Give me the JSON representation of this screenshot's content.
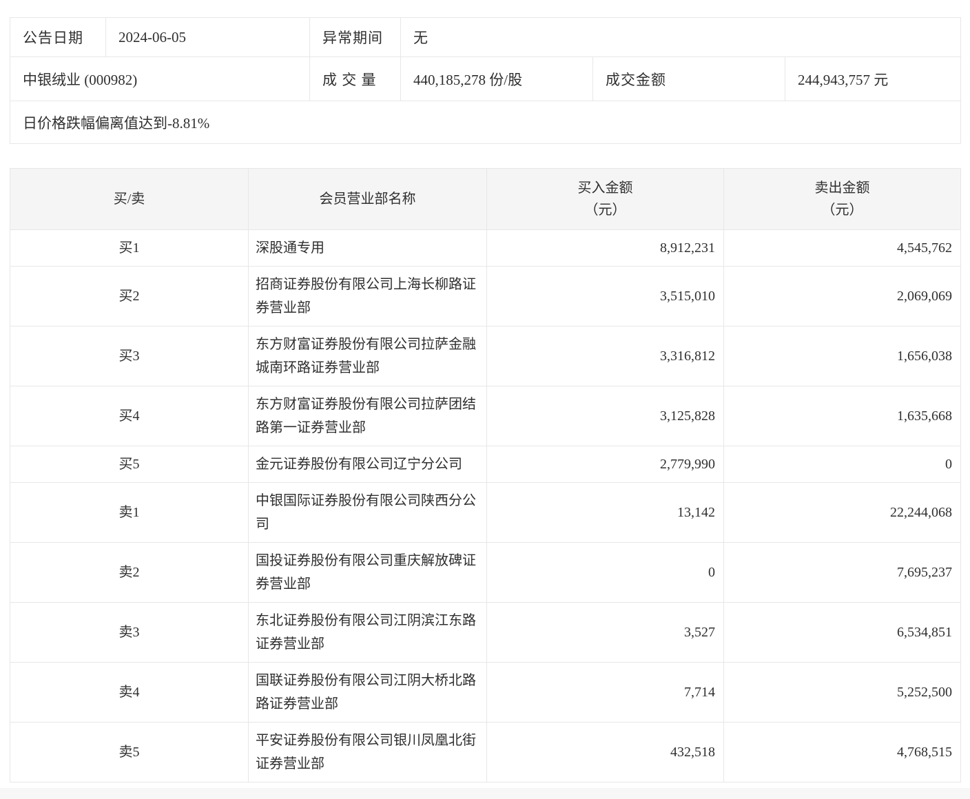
{
  "info_table": {
    "announce_date_label": "公告日期",
    "announce_date": "2024-06-05",
    "abnormal_period_label": "异常期间",
    "abnormal_period": "无",
    "stock_name": "中银绒业 (000982)",
    "volume_label": "成 交 量",
    "volume": "440,185,278 份/股",
    "turnover_label": "成交金额",
    "turnover": "244,943,757 元",
    "reason": "日价格跌幅偏离值达到-8.81%"
  },
  "broker_table": {
    "headers": {
      "side": "买/卖",
      "branch": "会员营业部名称",
      "buy_line1": "买入金额",
      "buy_line2": "（元）",
      "sell_line1": "卖出金额",
      "sell_line2": "（元）"
    },
    "rows": [
      {
        "side": "买1",
        "name": "深股通专用",
        "buy": "8,912,231",
        "sell": "4,545,762"
      },
      {
        "side": "买2",
        "name": "招商证券股份有限公司上海长柳路证券营业部",
        "buy": "3,515,010",
        "sell": "2,069,069"
      },
      {
        "side": "买3",
        "name": "东方财富证券股份有限公司拉萨金融城南环路证券营业部",
        "buy": "3,316,812",
        "sell": "1,656,038"
      },
      {
        "side": "买4",
        "name": "东方财富证券股份有限公司拉萨团结路第一证券营业部",
        "buy": "3,125,828",
        "sell": "1,635,668"
      },
      {
        "side": "买5",
        "name": "金元证券股份有限公司辽宁分公司",
        "buy": "2,779,990",
        "sell": "0"
      },
      {
        "side": "卖1",
        "name": "中银国际证券股份有限公司陕西分公司",
        "buy": "13,142",
        "sell": "22,244,068"
      },
      {
        "side": "卖2",
        "name": "国投证券股份有限公司重庆解放碑证券营业部",
        "buy": "0",
        "sell": "7,695,237"
      },
      {
        "side": "卖3",
        "name": "东北证券股份有限公司江阴滨江东路证券营业部",
        "buy": "3,527",
        "sell": "6,534,851"
      },
      {
        "side": "卖4",
        "name": "国联证券股份有限公司江阴大桥北路路证券营业部",
        "buy": "7,714",
        "sell": "5,252,500"
      },
      {
        "side": "卖5",
        "name": "平安证券股份有限公司银川凤凰北街证券营业部",
        "buy": "432,518",
        "sell": "4,768,515"
      }
    ]
  }
}
